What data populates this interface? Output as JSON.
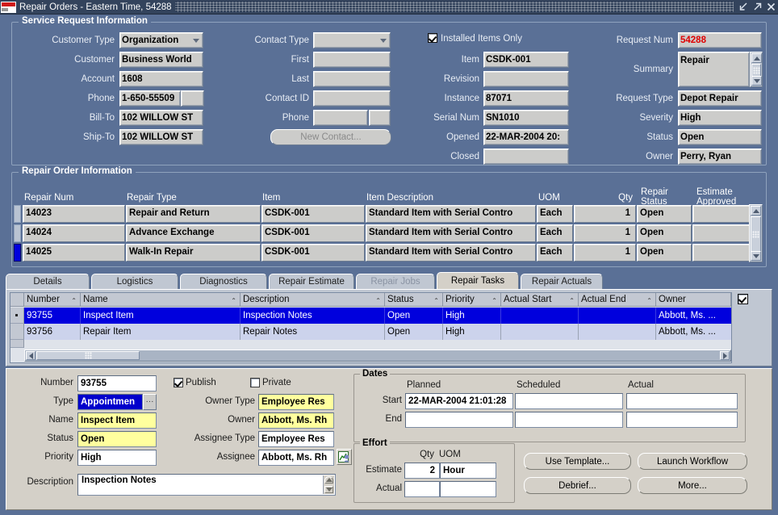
{
  "window": {
    "title": "Repair Orders - Eastern Time, 54288",
    "app_icon": "oracle-logo",
    "controls": [
      {
        "name": "minimize-button",
        "glyph": "minimize"
      },
      {
        "name": "maximize-button",
        "glyph": "maximize"
      },
      {
        "name": "close-button",
        "glyph": "close"
      }
    ]
  },
  "service_request": {
    "title": "Service Request Information",
    "left": {
      "customer_type_label": "Customer Type",
      "customer_type_value": "Organization",
      "customer_label": "Customer",
      "customer_value": "Business World",
      "account_label": "Account",
      "account_value": "1608",
      "phone_label": "Phone",
      "phone_value": "1-650-55509",
      "phone_ext_value": "",
      "bill_to_label": "Bill-To",
      "bill_to_value": "102 WILLOW ST",
      "ship_to_label": "Ship-To",
      "ship_to_value": "102 WILLOW ST"
    },
    "contact": {
      "contact_type_label": "Contact Type",
      "contact_type_value": "",
      "first_label": "First",
      "first_value": "",
      "last_label": "Last",
      "last_value": "",
      "contact_id_label": "Contact ID",
      "contact_id_value": "",
      "phone_label": "Phone",
      "phone_value": "",
      "phone_ext_value": "",
      "new_contact_button": "New Contact..."
    },
    "item": {
      "installed_items_only_label": "Installed Items Only",
      "installed_items_only_checked": true,
      "item_label": "Item",
      "item_value": "CSDK-001",
      "revision_label": "Revision",
      "revision_value": "",
      "instance_label": "Instance",
      "instance_value": "87071",
      "serial_num_label": "Serial Num",
      "serial_num_value": "SN1010",
      "opened_label": "Opened",
      "opened_value": "22-MAR-2004 20:",
      "closed_label": "Closed",
      "closed_value": ""
    },
    "request": {
      "request_num_label": "Request Num",
      "request_num_value": "54288",
      "request_num_color": "#e00000",
      "summary_label": "Summary",
      "summary_value": "Repair",
      "request_type_label": "Request Type",
      "request_type_value": "Depot Repair",
      "severity_label": "Severity",
      "severity_value": "High",
      "status_label": "Status",
      "status_value": "Open",
      "owner_label": "Owner",
      "owner_value": "Perry, Ryan"
    }
  },
  "repair_order": {
    "title": "Repair Order Information",
    "columns": [
      "Repair Num",
      "Repair Type",
      "Item",
      "Item Description",
      "UOM",
      "Qty",
      "Repair Status",
      "Estimate Approved"
    ],
    "rows": [
      {
        "repair_num": "14023",
        "repair_type": "Repair and Return",
        "item": "CSDK-001",
        "item_description": "Standard Item with Serial Contro",
        "uom": "Each",
        "qty": "1",
        "repair_status": "Open",
        "estimate_approved": "",
        "current": false
      },
      {
        "repair_num": "14024",
        "repair_type": "Advance Exchange",
        "item": "CSDK-001",
        "item_description": "Standard Item with Serial Contro",
        "uom": "Each",
        "qty": "1",
        "repair_status": "Open",
        "estimate_approved": "",
        "current": false
      },
      {
        "repair_num": "14025",
        "repair_type": "Walk-In Repair",
        "item": "CSDK-001",
        "item_description": "Standard Item with Serial Contro",
        "uom": "Each",
        "qty": "1",
        "repair_status": "Open",
        "estimate_approved": "",
        "current": true
      }
    ]
  },
  "tabs": [
    {
      "label": "Details",
      "state": "normal"
    },
    {
      "label": "Logistics",
      "state": "normal"
    },
    {
      "label": "Diagnostics",
      "state": "normal"
    },
    {
      "label": "Repair Estimate",
      "state": "normal"
    },
    {
      "label": "Repair Jobs",
      "state": "disabled"
    },
    {
      "label": "Repair Tasks",
      "state": "active"
    },
    {
      "label": "Repair Actuals",
      "state": "normal"
    }
  ],
  "task_grid": {
    "columns": [
      "Number",
      "Name",
      "Description",
      "Status",
      "Priority",
      "Actual Start",
      "Actual End",
      "Owner"
    ],
    "rows": [
      {
        "number": "93755",
        "name": "Inspect Item",
        "description": "Inspection Notes",
        "status": "Open",
        "priority": "High",
        "actual_start": "",
        "actual_end": "",
        "owner": "Abbott, Ms. ...",
        "selected": true
      },
      {
        "number": "93756",
        "name": "Repair Item",
        "description": "Repair Notes",
        "status": "Open",
        "priority": "High",
        "actual_start": "",
        "actual_end": "",
        "owner": "Abbott, Ms. ...",
        "selected": false
      }
    ],
    "side_checkbox_checked": true
  },
  "task_detail": {
    "number_label": "Number",
    "number_value": "93755",
    "type_label": "Type",
    "type_value": "Appointmen",
    "name_label": "Name",
    "name_value": "Inspect Item",
    "status_label": "Status",
    "status_value": "Open",
    "priority_label": "Priority",
    "priority_value": "High",
    "description_label": "Description",
    "description_value": "Inspection Notes",
    "publish_label": "Publish",
    "publish_checked": true,
    "private_label": "Private",
    "private_checked": false,
    "owner_type_label": "Owner Type",
    "owner_type_value": "Employee Res",
    "owner_label": "Owner",
    "owner_value": "Abbott, Ms. Rh",
    "assignee_type_label": "Assignee Type",
    "assignee_type_value": "Employee Res",
    "assignee_label": "Assignee",
    "assignee_value": "Abbott, Ms. Rh",
    "assignee_icon": "resource-lookup-icon"
  },
  "dates": {
    "title": "Dates",
    "col_planned": "Planned",
    "col_scheduled": "Scheduled",
    "col_actual": "Actual",
    "row_start": "Start",
    "row_end": "End",
    "planned_start": "22-MAR-2004 21:01:28",
    "planned_end": "",
    "scheduled_start": "",
    "scheduled_end": "",
    "actual_start": "",
    "actual_end": ""
  },
  "effort": {
    "title": "Effort",
    "col_qty": "Qty",
    "col_uom": "UOM",
    "row_estimate": "Estimate",
    "row_actual": "Actual",
    "estimate_qty": "2",
    "estimate_uom": "Hour",
    "actual_qty": "",
    "actual_uom": ""
  },
  "action_buttons": [
    {
      "label": "Use Template..."
    },
    {
      "label": "Launch Workflow"
    },
    {
      "label": "Debrief..."
    },
    {
      "label": "More..."
    }
  ]
}
